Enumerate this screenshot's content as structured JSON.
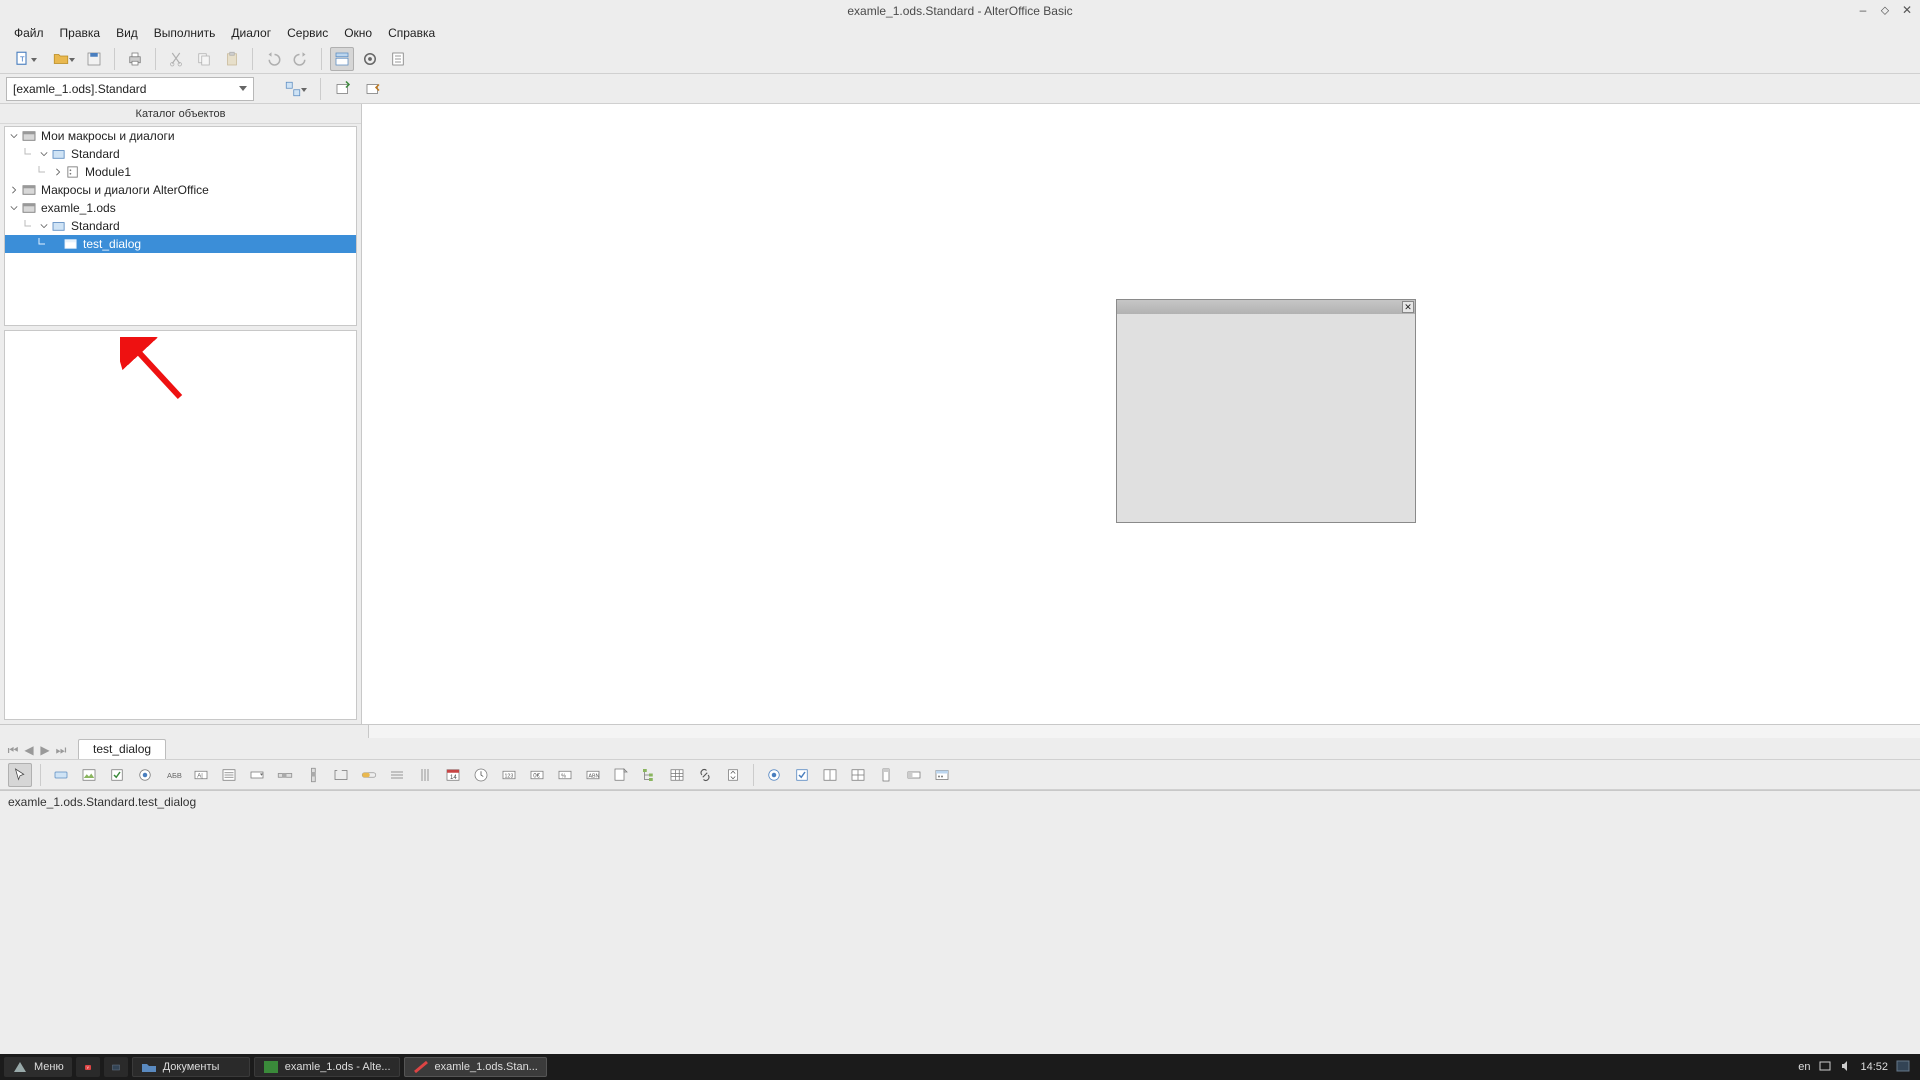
{
  "title": "examle_1.ods.Standard - AlterOffice Basic",
  "menu": {
    "file": "Файл",
    "edit": "Правка",
    "view": "Вид",
    "run": "Выполнить",
    "dialog": "Диалог",
    "tools": "Сервис",
    "window": "Окно",
    "help": "Справка"
  },
  "library_combo": "[examle_1.ods].Standard",
  "catalog_title": "Каталог объектов",
  "tree": {
    "my_macros": "Мои макросы и диалоги",
    "my_standard": "Standard",
    "my_module1": "Module1",
    "ao_macros": "Макросы и диалоги AlterOffice",
    "doc": "examle_1.ods",
    "doc_standard": "Standard",
    "doc_dialog": "test_dialog"
  },
  "tab_label": "test_dialog",
  "statusbar": "examle_1.ods.Standard.test_dialog",
  "taskbar": {
    "menu": "Меню",
    "fm": "Документы",
    "win1": "examle_1.ods - Alte...",
    "win2": "examle_1.ods.Stan...",
    "lang": "en",
    "time": "14:52"
  },
  "icons": {
    "toolbar": [
      "new-module",
      "open",
      "save-dialog",
      "print",
      "cut",
      "copy",
      "paste",
      "clipboard",
      "undo",
      "redo",
      "find-replace",
      "object-catalog",
      "macros"
    ],
    "row2": [
      "select-macro",
      "separator",
      "dialog-import",
      "dialog-export"
    ],
    "controls": [
      "selection",
      "push-button",
      "image-control",
      "line",
      "rectangle",
      "check-box",
      "option-button",
      "label",
      "text-box",
      "list-box",
      "combo-box",
      "scrollbar-h",
      "scrollbar-v",
      "frame",
      "progress-bar",
      "line-h",
      "line-v",
      "date-field",
      "time-field",
      "numeric-field",
      "currency-field",
      "formatted-field",
      "pattern-field",
      "file-selection",
      "tree-control",
      "table-control",
      "hyperlink",
      "spin",
      "separator",
      "option-group",
      "check-group",
      "group-box",
      "grid-control",
      "nav-bar",
      "properties",
      "test-mode"
    ]
  }
}
